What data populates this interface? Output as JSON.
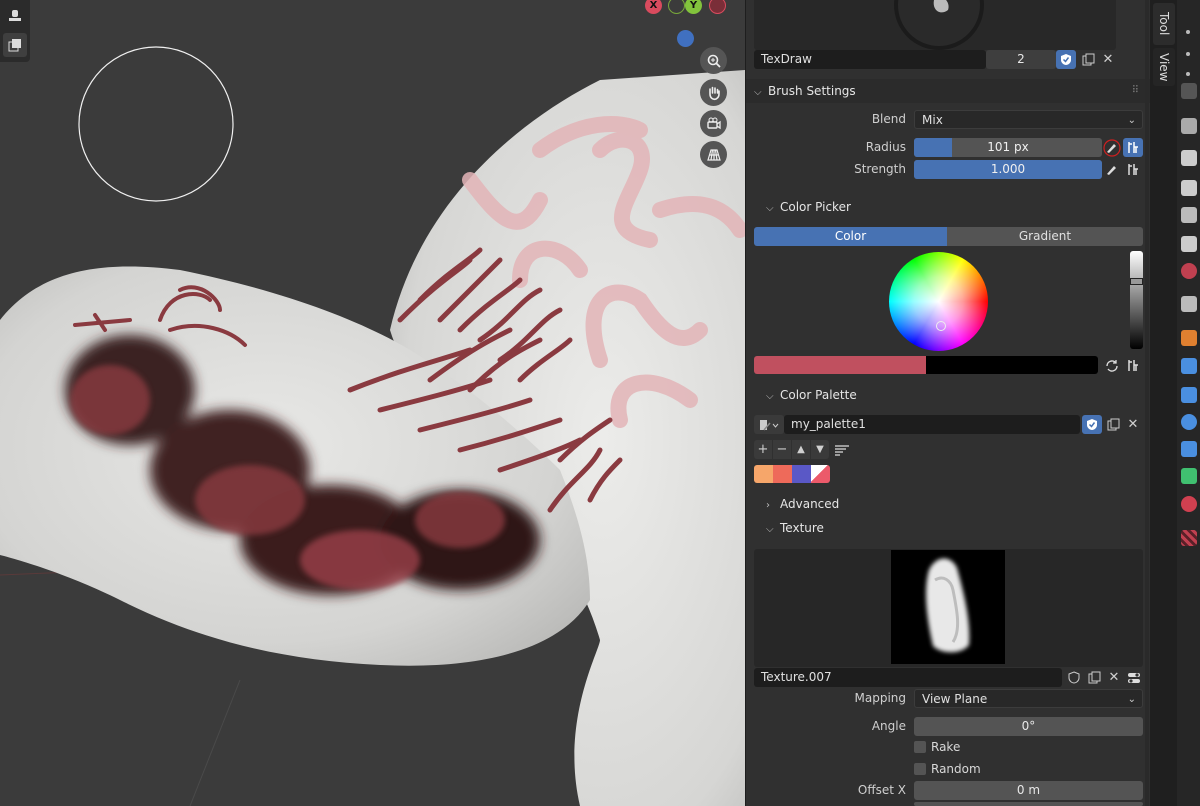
{
  "panel": {
    "brush_name": "TexDraw",
    "brush_users": "2",
    "brush_settings": {
      "header": "Brush Settings",
      "blend_label": "Blend",
      "blend_value": "Mix",
      "radius_label": "Radius",
      "radius_value": "101 px",
      "strength_label": "Strength",
      "strength_value": "1.000",
      "strength_fraction": 1.0,
      "radius_fill_fraction": 0.2
    },
    "color_picker": {
      "header": "Color Picker",
      "tab_color": "Color",
      "tab_gradient": "Gradient",
      "primary_color": "#c0505f",
      "secondary_color": "#000000"
    },
    "color_palette": {
      "header": "Color Palette",
      "palette_name": "my_palette1",
      "swatches": [
        "#f6a66a",
        "#ee6a5a",
        "#5a58c6",
        "#ec5a6a"
      ]
    },
    "advanced": {
      "header": "Advanced"
    },
    "texture": {
      "header": "Texture",
      "texture_name": "Texture.007",
      "mapping_label": "Mapping",
      "mapping_value": "View Plane",
      "angle_label": "Angle",
      "angle_value": "0°",
      "rake_label": "Rake",
      "random_label": "Random",
      "offset_x_label": "Offset X",
      "offset_x_value": "0 m"
    }
  },
  "tabs": {
    "tool": "Tool",
    "view": "View"
  },
  "gizmo": {
    "x_label": "X",
    "y_label": "Y"
  },
  "colors": {
    "accent": "#4772b3",
    "panel_bg": "#303030",
    "viewport_bg": "#3b3b3b"
  }
}
